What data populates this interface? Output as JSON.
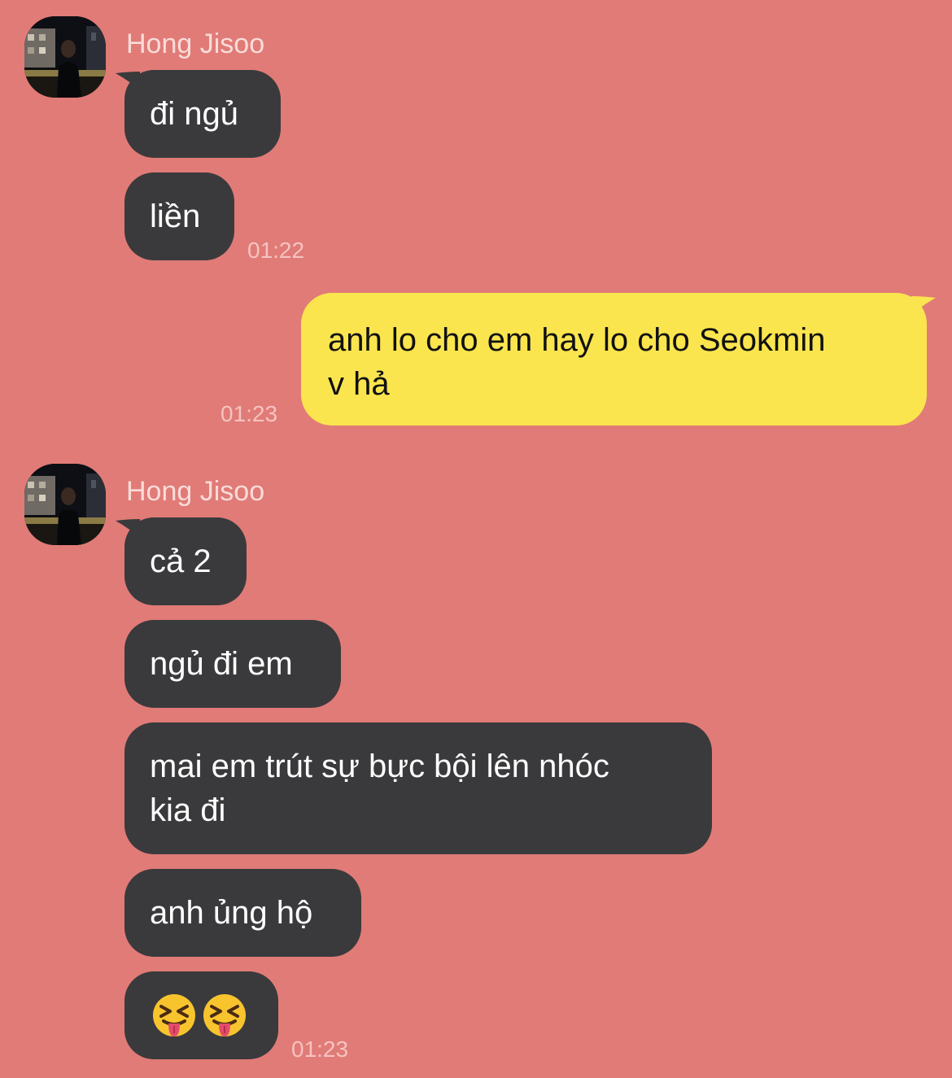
{
  "sender": {
    "name": "Hong Jisoo"
  },
  "groups": [
    {
      "messages": [
        "đi ngủ",
        "liền"
      ],
      "time": "01:22"
    },
    {
      "outgoing_lines": [
        "anh lo cho em hay lo cho Seokmin",
        "v hả"
      ],
      "time": "01:23"
    },
    {
      "messages": [
        "cả 2",
        "ngủ đi em",
        "mai em trút sự bực bội lên nhóc",
        "kia đi",
        "anh ủng hộ"
      ],
      "emoji_message": [
        "squinting-face-with-tongue",
        "squinting-face-with-tongue"
      ],
      "time": "01:23"
    }
  ],
  "colors": {
    "background": "#e17b77",
    "incoming_bubble": "#3a3a3c",
    "outgoing_bubble": "#fbe54e"
  }
}
